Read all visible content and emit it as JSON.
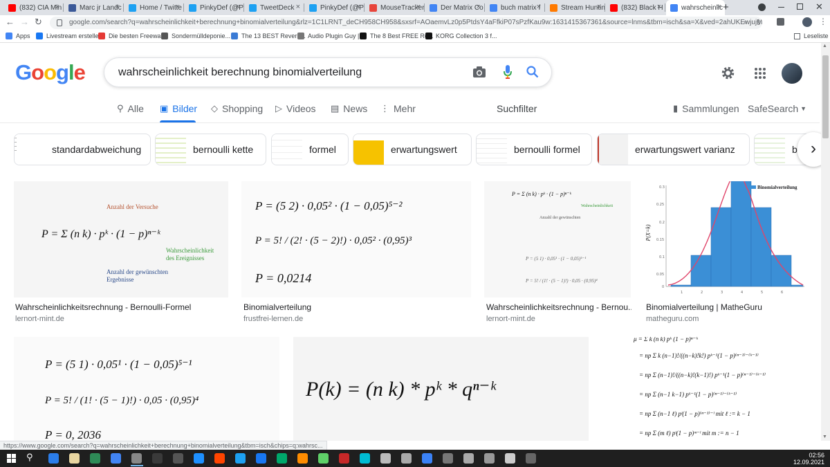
{
  "browser": {
    "tabs": [
      {
        "label": "(832) CIA Min",
        "color": "#ff0000"
      },
      {
        "label": "Marc jr Landc",
        "color": "#3b5998"
      },
      {
        "label": "Home / Twitte",
        "color": "#1da1f2"
      },
      {
        "label": "PinkyDef (@Pi",
        "color": "#1da1f2"
      },
      {
        "label": "TweetDeck",
        "color": "#1da1f2"
      },
      {
        "label": "PinkyDef (@Pi",
        "color": "#1da1f2"
      },
      {
        "label": "MouseTracker",
        "color": "#e8453c"
      },
      {
        "label": "Der Matrix Co",
        "color": "#4285f4"
      },
      {
        "label": "buch matrix f",
        "color": "#4285f4"
      },
      {
        "label": "Stream Huntin",
        "color": "#ff7a00"
      },
      {
        "label": "(832) Black H",
        "color": "#ff0000"
      },
      {
        "label": "wahrscheinlic",
        "color": "#4285f4"
      }
    ],
    "new_tab": "+",
    "url": "google.com/search?q=wahrscheinlichkeit+berechnung+binomialverteilung&rlz=1C1LRNT_deCH958CH958&sxsrf=AOaemvLz0p5PtdsY4aFfkiP07sPzfKau9w:1631415367361&source=lnms&tbm=isch&sa=X&ved=2ahUKEwjujM_rt_jyAhWM-KQKHb_uAkA...",
    "bookmarks": [
      {
        "label": "Apps",
        "color": "#4285f4"
      },
      {
        "label": "Livestream erstellen",
        "color": "#1877f2"
      },
      {
        "label": "Die besten Freewar...",
        "color": "#e53935"
      },
      {
        "label": "Sondermülldeponie...",
        "color": "#555555"
      },
      {
        "label": "The 13 BEST Reverb...",
        "color": "#3a7bd5"
      },
      {
        "label": "Audio Plugin Guy |...",
        "color": "#777777"
      },
      {
        "label": "The 8 Best FREE Re...",
        "color": "#111111"
      },
      {
        "label": "KORG Collection 3 f...",
        "color": "#111111"
      }
    ],
    "reading_list": "Leseliste"
  },
  "search": {
    "query": "wahrscheinlichkeit berechnung binomialverteilung",
    "logo": "Google"
  },
  "nav": {
    "tabs": [
      {
        "label": "Alle",
        "icon": "search-icon"
      },
      {
        "label": "Bilder",
        "icon": "image-icon"
      },
      {
        "label": "Shopping",
        "icon": "tag-icon"
      },
      {
        "label": "Videos",
        "icon": "play-icon"
      },
      {
        "label": "News",
        "icon": "news-icon"
      },
      {
        "label": "Mehr",
        "icon": "more-icon"
      }
    ],
    "suchfilter": "Suchfilter",
    "sammlungen": "Sammlungen",
    "safesearch": "SafeSearch"
  },
  "chips": [
    {
      "label": "standardabweichung"
    },
    {
      "label": "bernoulli kette"
    },
    {
      "label": "formel"
    },
    {
      "label": "erwartungswert"
    },
    {
      "label": "bernoulli formel"
    },
    {
      "label": "erwartungswert varianz"
    },
    {
      "label": "be"
    }
  ],
  "results": [
    {
      "title": "Wahrscheinlichkeitsrechnung - Bernoulli-Formel",
      "site": "lernort-mint.de"
    },
    {
      "title": "Binomialverteilung",
      "site": "frustfrei-lernen.de"
    },
    {
      "title": "Wahrscheinlichkeitsrechnung - Bernou...",
      "site": "lernort-mint.de"
    },
    {
      "title": "Binomialverteilung | MatheGuru",
      "site": "matheguru.com"
    }
  ],
  "image_text": {
    "r1": {
      "formula": "P = Σ (n k) · pᵏ · (1 − p)ⁿ⁻ᵏ",
      "label_n": "Anzahl der Versuche",
      "label_p1": "Wahrscheinlichkeit",
      "label_p2": "des Ereignisses",
      "label_k1": "Anzahl der gewünschten",
      "label_k2": "Ergebnisse"
    },
    "r2": {
      "line1": "P = (5 2) · 0,05² · (1 − 0,05)⁵⁻²",
      "line2": "P = 5! / (2! · (5 − 2)!) · 0,05² · (0,95)³",
      "line3": "P = 0,0214"
    },
    "r4": {
      "legend": "Binomialverteilung",
      "ylabel": "P(X=k)"
    },
    "r5": {
      "line1": "P = (5 1) · 0,05¹ · (1 − 0,05)⁵⁻¹",
      "line2": "P = 5! / (1! · (5 − 1)!) · 0,05 · (0,95)⁴",
      "line3": "P = 0, 2036"
    },
    "r6": {
      "formula": "P(k) = (n k) * pᵏ * qⁿ⁻ᵏ"
    },
    "r7": {
      "line1": "μ = Σ k (n k) pᵏ (1 − p)ⁿ⁻ᵏ",
      "line2": "= np Σ k (n−1)!/((n−k)!k!) pᵏ⁻¹(1 − p)⁽ⁿ⁻¹⁾⁻⁽ᵏ⁻¹⁾",
      "line3": "= np Σ (n−1)!/((n−k)!(k−1)!) pᵏ⁻¹(1 − p)⁽ⁿ⁻¹⁾⁻⁽ᵏ⁻¹⁾",
      "line4": "= np Σ (n−1 k−1) pᵏ⁻¹(1 − p)⁽ⁿ⁻¹⁾⁻⁽ᵏ⁻¹⁾",
      "line5": "= np Σ (n−1 ℓ) pˡ(1 − p)⁽ⁿ⁻¹⁾⁻ˡ   mit ℓ := k − 1",
      "line6": "= np Σ (m ℓ) pˡ(1 − p)ᵐ⁻ˡ   mit m := n − 1"
    }
  },
  "status_url": "https://www.google.com/search?q=wahrscheinlichkeit+berechnung+binomialverteilung&tbm=isch&chips=q:wahrsc...",
  "taskbar": {
    "time": "02:56",
    "date": "12.09.2021"
  }
}
